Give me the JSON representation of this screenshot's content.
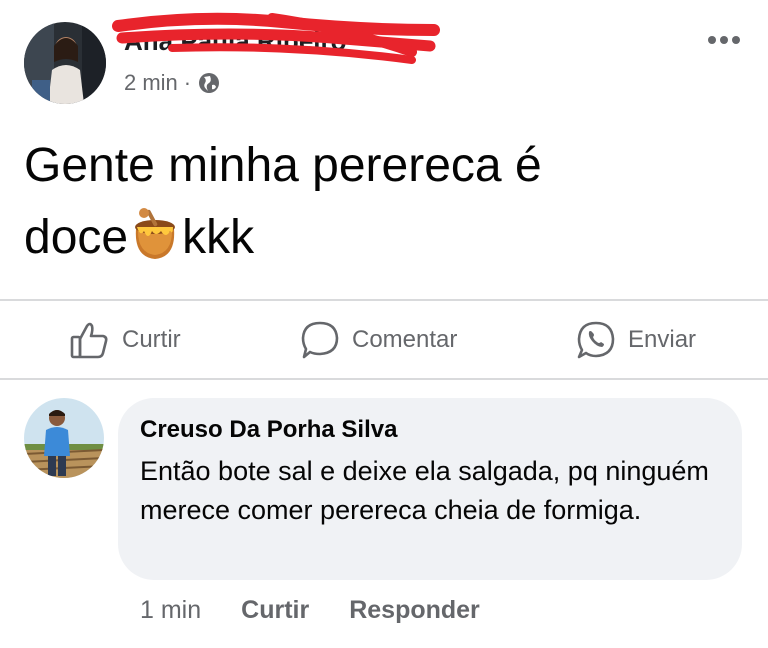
{
  "post": {
    "author": "Ana Paula Ribeiro",
    "time": "2 min",
    "separator": "·",
    "privacy_icon": "globe-icon",
    "more_icon": "more-icon",
    "text_line1": "Gente minha perereca é",
    "text_line2_prefix": "doce",
    "emoji": "honey-pot-icon",
    "text_line2_suffix": "kkk"
  },
  "actions": {
    "like": "Curtir",
    "comment": "Comentar",
    "share": "Enviar"
  },
  "comment": {
    "author": "Creuso Da Porha Silva",
    "text": "Então bote sal e deixe ela salgada, pq ninguém merece comer perereca cheia de formiga.",
    "time": "1 min",
    "like": "Curtir",
    "reply": "Responder"
  },
  "colors": {
    "name_scribble": "#e8242c",
    "secondary_text": "#65676b",
    "bubble_bg": "#f0f2f5",
    "divider": "#d9dadc"
  }
}
